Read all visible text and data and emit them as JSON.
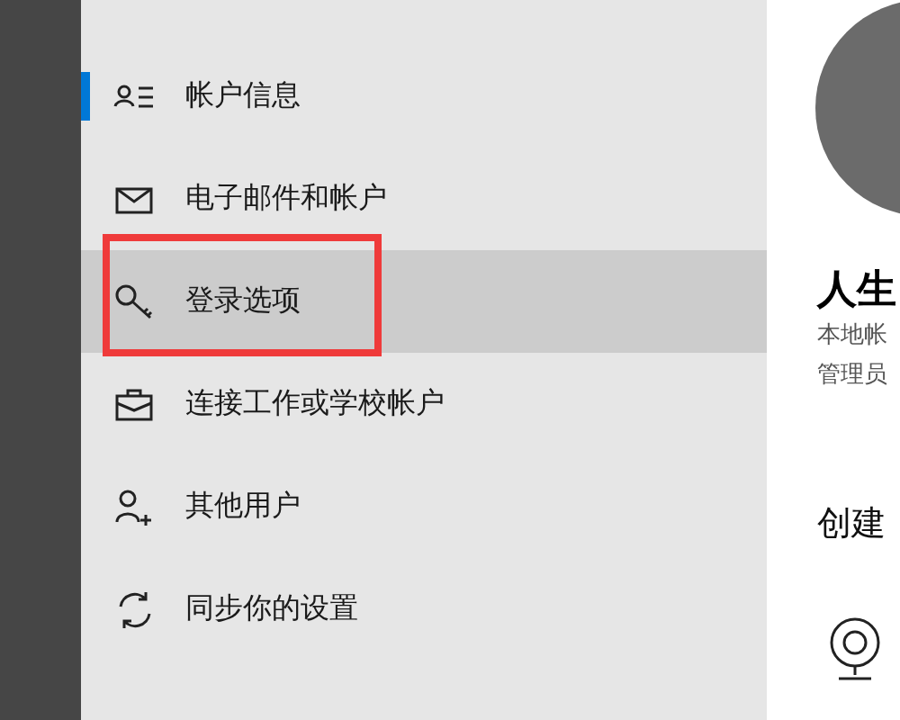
{
  "sidebar": {
    "items": [
      {
        "kind": "person-list",
        "label": "帐户信息",
        "selected": true,
        "highlighted": false,
        "annotated": false
      },
      {
        "kind": "mail",
        "label": "电子邮件和帐户",
        "selected": false,
        "highlighted": false,
        "annotated": false
      },
      {
        "kind": "key",
        "label": "登录选项",
        "selected": false,
        "highlighted": true,
        "annotated": true
      },
      {
        "kind": "briefcase",
        "label": "连接工作或学校帐户",
        "selected": false,
        "highlighted": false,
        "annotated": false
      },
      {
        "kind": "person-add",
        "label": "其他用户",
        "selected": false,
        "highlighted": false,
        "annotated": false
      },
      {
        "kind": "sync",
        "label": "同步你的设置",
        "selected": false,
        "highlighted": false,
        "annotated": false
      }
    ]
  },
  "account": {
    "name": "人生",
    "details": [
      "本地帐",
      "管理员"
    ]
  },
  "section": {
    "title": "创建"
  }
}
